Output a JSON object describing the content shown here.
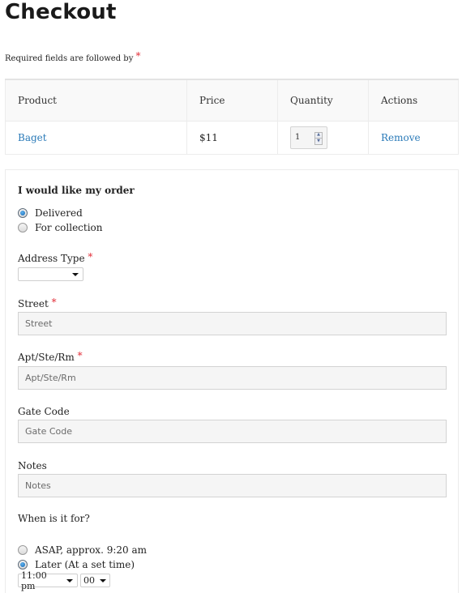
{
  "page": {
    "title": "Checkout",
    "required_note": "Required fields are followed by",
    "required_marker": "*"
  },
  "cart": {
    "columns": [
      "Product",
      "Price",
      "Quantity",
      "Actions"
    ],
    "rows": [
      {
        "product": "Baget",
        "price": "$11",
        "quantity": "1",
        "action": "Remove"
      }
    ]
  },
  "order_form": {
    "delivery_heading": "I would like my order",
    "delivery_options": [
      {
        "label": "Delivered",
        "checked": true
      },
      {
        "label": "For collection",
        "checked": false
      }
    ],
    "address_type": {
      "label": "Address Type",
      "required": true,
      "value": ""
    },
    "fields": [
      {
        "label": "Street",
        "required": true,
        "placeholder": "Street"
      },
      {
        "label": "Apt/Ste/Rm",
        "required": true,
        "placeholder": "Apt/Ste/Rm"
      },
      {
        "label": "Gate Code",
        "required": false,
        "placeholder": "Gate Code"
      },
      {
        "label": "Notes",
        "required": false,
        "placeholder": "Notes"
      }
    ],
    "timing_heading": "When is it for?",
    "timing_options": [
      {
        "label": "ASAP, approx. 9:20 am",
        "checked": false
      },
      {
        "label": "Later (At a set time)",
        "checked": true
      }
    ],
    "time_select": {
      "hour": "11:00 pm",
      "minute": "00"
    }
  }
}
